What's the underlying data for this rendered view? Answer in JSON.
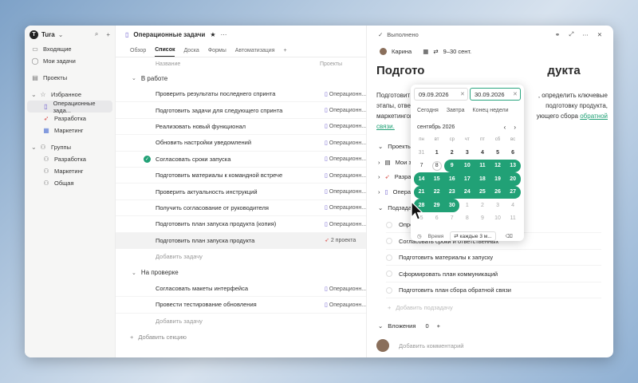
{
  "sidebar": {
    "workspace": "Tura",
    "items": [
      {
        "label": "Входящие"
      },
      {
        "label": "Мои задачи"
      },
      {
        "label": "Проекты"
      },
      {
        "label": "Избранное"
      },
      {
        "label": "Операционные зада..."
      },
      {
        "label": "Разработка"
      },
      {
        "label": "Маркетинг"
      },
      {
        "label": "Группы"
      },
      {
        "label": "Разработка"
      },
      {
        "label": "Маркетинг"
      },
      {
        "label": "Общая"
      }
    ]
  },
  "main": {
    "title": "Операционные задачи",
    "tabs": [
      {
        "label": "Обзор"
      },
      {
        "label": "Список"
      },
      {
        "label": "Доска"
      },
      {
        "label": "Формы"
      },
      {
        "label": "Автоматизация"
      }
    ],
    "col_name": "Название",
    "col_projects": "Проекты",
    "sections": [
      {
        "title": "В работе",
        "tasks": [
          {
            "name": "Проверить результаты последнего спринта",
            "project": "Операционн..."
          },
          {
            "name": "Подготовить задачи для следующего спринта",
            "project": "Операционн..."
          },
          {
            "name": "Реализовать новый функционал",
            "project": "Операционн..."
          },
          {
            "name": "Обновить настройки уведомлений",
            "project": "Операционн..."
          },
          {
            "name": "Согласовать сроки запуска",
            "project": "Операционн..."
          },
          {
            "name": "Подготовить материалы к командной встрече",
            "project": "Операционн..."
          },
          {
            "name": "Проверить актуальность инструкций",
            "project": "Операционн..."
          },
          {
            "name": "Получить согласование от руководителя",
            "project": "Операционн..."
          },
          {
            "name": "Подготовить план запуска продукта (копия)",
            "project": "Операционн..."
          },
          {
            "name": "Подготовить план запуска продукта",
            "project": "2 проекта"
          }
        ],
        "add_task": "Добавить задачу"
      },
      {
        "title": "На проверке",
        "tasks": [
          {
            "name": "Согласовать макеты интерфейса",
            "project": "Операционн..."
          },
          {
            "name": "Провести тестирование обновления",
            "project": "Операционн..."
          }
        ],
        "add_task": "Добавить задачу"
      }
    ],
    "add_section": "Добавить секцию"
  },
  "detail": {
    "status": "Выполнено",
    "assignee": "Карина",
    "dates": "9–30 сент.",
    "title": "Подготовить план запуска продукта",
    "title_visible": "Подгото",
    "title_tail": "дукта",
    "desc_lines": [
      {
        "left": "Подготовит",
        "right": ", определить ключевые"
      },
      {
        "left": "этапы, ответ",
        "right": "подготовку продукта,"
      },
      {
        "left": "маркетингов",
        "right": "ующего сбора"
      },
      {
        "left": "связи.",
        "right": ""
      }
    ],
    "desc_link": "обратной",
    "projects_label": "Проекты",
    "project_rows": [
      {
        "label": "Мои за"
      },
      {
        "label": "Разра"
      },
      {
        "label": "Опера"
      }
    ],
    "subtasks_label": "Подзада",
    "subtasks": [
      {
        "name": "Определить ключевые этапы запуска"
      },
      {
        "name": "Согласовать сроки и ответственных"
      },
      {
        "name": "Подготовить материалы к запуску"
      },
      {
        "name": "Сформировать план коммуникаций"
      },
      {
        "name": "Подготовить план сбора обратной связи"
      }
    ],
    "add_subtask": "Добавить подзадачу",
    "attachments_label": "Вложения",
    "attachments_count": "0",
    "add_comment": "Добавить комментарий"
  },
  "calendar": {
    "start": "09.09.2026",
    "end": "30.09.2026",
    "quick": [
      "Сегодня",
      "Завтра",
      "Конец недели"
    ],
    "month": "сентябрь 2026",
    "weekdays": [
      "пн",
      "вт",
      "ср",
      "чт",
      "пт",
      "сб",
      "вс"
    ],
    "days": [
      "31",
      "1",
      "2",
      "3",
      "4",
      "5",
      "6",
      "7",
      "8",
      "9",
      "10",
      "11",
      "12",
      "13",
      "14",
      "15",
      "16",
      "17",
      "18",
      "19",
      "20",
      "21",
      "22",
      "23",
      "24",
      "25",
      "26",
      "27",
      "28",
      "29",
      "30",
      "1",
      "2",
      "3",
      "4",
      "5",
      "6",
      "7",
      "8",
      "9",
      "10",
      "11"
    ],
    "time_label": "Время",
    "repeat_label": "каждые 3 м..."
  },
  "colors": {
    "accent": "#21a176"
  }
}
